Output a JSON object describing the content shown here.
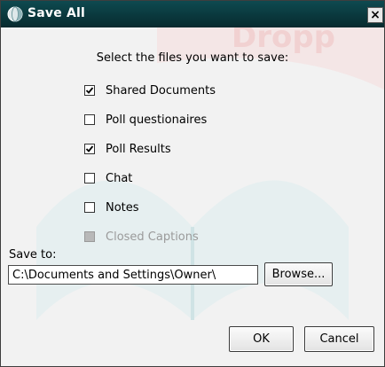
{
  "window": {
    "title": "Save All",
    "close_label": "×",
    "icon": "globe-icon",
    "watermark_text": "Dropp"
  },
  "instruction": "Select the files you want to save:",
  "files": [
    {
      "label": "Shared Documents",
      "checked": true,
      "enabled": true
    },
    {
      "label": "Poll questionaires",
      "checked": false,
      "enabled": true
    },
    {
      "label": "Poll Results",
      "checked": true,
      "enabled": true
    },
    {
      "label": "Chat",
      "checked": false,
      "enabled": true
    },
    {
      "label": "Notes",
      "checked": false,
      "enabled": true
    },
    {
      "label": "Closed Captions",
      "checked": false,
      "enabled": false
    }
  ],
  "save_to": {
    "label": "Save to:",
    "path": "C:\\Documents and Settings\\Owner\\"
  },
  "buttons": {
    "browse": "Browse...",
    "ok": "OK",
    "cancel": "Cancel"
  },
  "colors": {
    "titlebar": "#0b3f44",
    "watermark_teal": "#d8ebec",
    "watermark_red": "#f3b2b2"
  }
}
